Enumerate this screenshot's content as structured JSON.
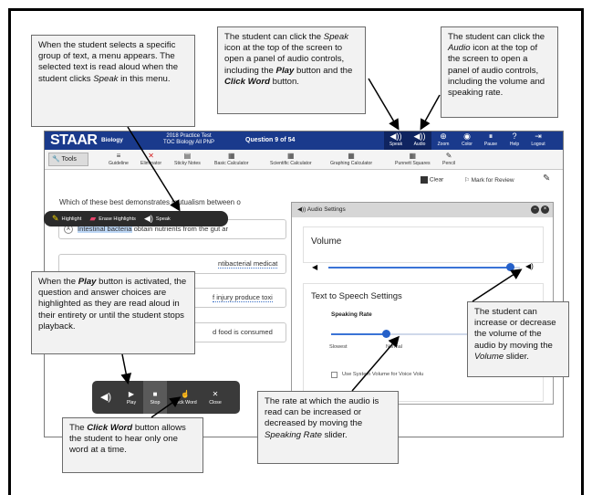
{
  "callouts": {
    "menu": "When the student selects a specific group of text, a menu appears. The selected text is read aloud when the student clicks",
    "menu_em": "Speak",
    "menu_tail": "in this menu.",
    "speak_1": "The student can click the",
    "speak_em": "Speak",
    "speak_2": "icon at the top of the screen to open a panel of audio controls, including the",
    "speak_play": "Play",
    "speak_3": "button and the",
    "speak_click": "Click Word",
    "speak_4": "button.",
    "audio_1": "The student can click the",
    "audio_em": "Audio",
    "audio_2": "icon at the top of the screen to open a panel of audio controls, including the volume and speaking rate.",
    "play_1": "When the",
    "play_em": "Play",
    "play_2": "button is activated, the question and answer choices are highlighted as they are read aloud in their entirety or until the student stops playback.",
    "volume_1": "The student can increase or decrease the volume of the audio by moving the",
    "volume_em": "Volume",
    "volume_2": "slider.",
    "clickword_1": "The",
    "clickword_em": "Click Word",
    "clickword_2": "button allows the student to hear only one word at a time.",
    "rate_1": "The rate at which the audio is read can be increased or decreased by moving the",
    "rate_em": "Speaking Rate",
    "rate_2": "slider."
  },
  "app": {
    "logo": "STAAR",
    "subject": "Biology",
    "test_line1": "2018 Practice Test",
    "test_line2": "TOC Biology All PNP",
    "question_num": "Question 9 of 54",
    "top_icons": [
      {
        "label": "Speak",
        "icon": "speak-icon",
        "glyph": "◀))"
      },
      {
        "label": "Audio",
        "icon": "audio-icon",
        "glyph": "◀))"
      },
      {
        "label": "Zoom",
        "icon": "zoom-icon",
        "glyph": "⊕"
      },
      {
        "label": "Color",
        "icon": "eye-icon",
        "glyph": "◉"
      },
      {
        "label": "Pause",
        "icon": "pause-icon",
        "glyph": "⏸"
      },
      {
        "label": "Help",
        "icon": "help-icon",
        "glyph": "?"
      },
      {
        "label": "Logout",
        "icon": "logout-icon",
        "glyph": "⇥"
      }
    ],
    "tools_label": "Tools",
    "tools": [
      {
        "label": "Guideline",
        "glyph": "≡"
      },
      {
        "label": "Eliminator",
        "glyph": "✕"
      },
      {
        "label": "Sticky Notes",
        "glyph": "▤"
      },
      {
        "label": "Basic Calculator",
        "glyph": "▦"
      },
      {
        "label": "Scientific Calculator",
        "glyph": "▦"
      },
      {
        "label": "Graphing Calculator",
        "glyph": "▦"
      },
      {
        "label": "Punnett Squares",
        "glyph": "▦"
      },
      {
        "label": "Pencil",
        "glyph": "✎"
      }
    ],
    "clear_label": "Clear",
    "review_label": "Mark for Review",
    "question": "Which of these best demonstrates mutualism between o",
    "choices": [
      {
        "letter": "A",
        "pre": "Intestinal bacteria",
        "post": " obtain nutrients from the gut ar"
      },
      {
        "letter": "B",
        "pre": "",
        "post": "ntibacterial medicat"
      },
      {
        "letter": "C",
        "pre": "",
        "post": "f injury produce toxi"
      },
      {
        "letter": "D",
        "pre": "",
        "post": "d food is consumed"
      }
    ],
    "highlight_menu": {
      "highlight": "Highlight",
      "erase": "Erase Highlights",
      "speak": "Speak"
    }
  },
  "audio_panel": {
    "title": "Audio Settings",
    "volume_title": "Volume",
    "volume_level": 0.95,
    "tts_title": "Text to Speech Settings",
    "rate_label": "Speaking Rate",
    "rate_level": 0.4,
    "slowest_label": "Slowest",
    "normal_label": "Normal",
    "system_volume_label": "Use System Volume for Voice Volu"
  },
  "play_bar": {
    "play": "Play",
    "stop": "Stop",
    "click_word": "Click Word",
    "close": "Close"
  }
}
